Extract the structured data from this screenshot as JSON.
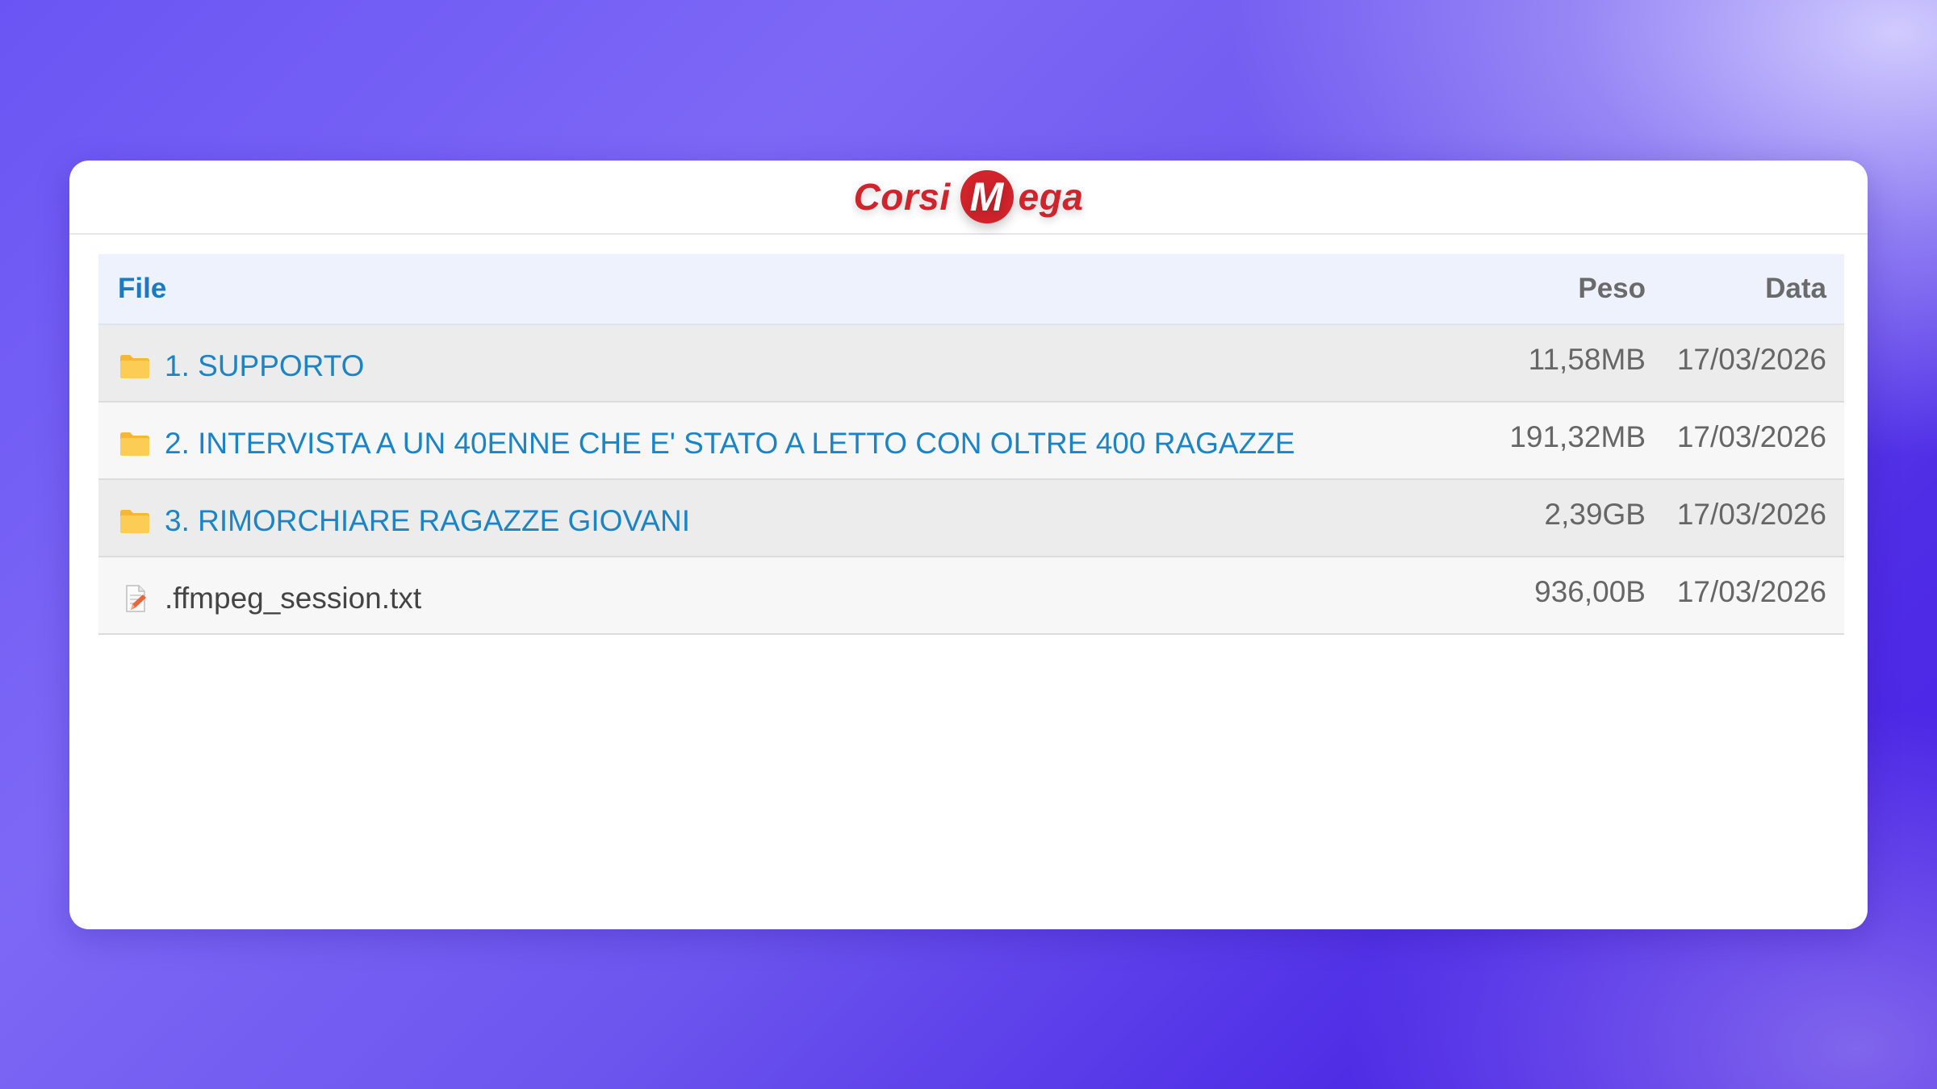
{
  "brand": {
    "logo_text_left": "Corsi",
    "logo_letter": "M",
    "logo_text_right": "ega",
    "color": "#d0232b"
  },
  "table": {
    "headers": {
      "file": "File",
      "size": "Peso",
      "date": "Data"
    },
    "rows": [
      {
        "type": "folder",
        "icon": "folder-icon",
        "name": "1. SUPPORTO",
        "size": "11,58MB",
        "date": "17/03/2026"
      },
      {
        "type": "folder",
        "icon": "folder-icon",
        "name": "2. INTERVISTA A UN 40ENNE CHE E' STATO A LETTO CON OLTRE 400 RAGAZZE",
        "size": "191,32MB",
        "date": "17/03/2026"
      },
      {
        "type": "folder",
        "icon": "folder-icon",
        "name": "3. RIMORCHIARE RAGAZZE GIOVANI",
        "size": "2,39GB",
        "date": "17/03/2026"
      },
      {
        "type": "file",
        "icon": "text-file-icon",
        "name": ".ffmpeg_session.txt",
        "size": "936,00B",
        "date": "17/03/2026"
      }
    ]
  },
  "colors": {
    "link": "#1a84c7",
    "header_link": "#1a7bc2",
    "folder": "#f7c44a"
  }
}
